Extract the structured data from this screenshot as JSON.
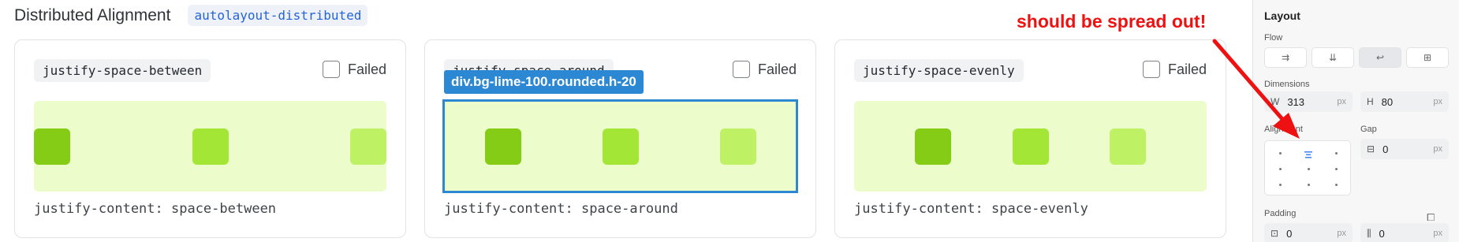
{
  "header": {
    "title": "Distributed Alignment",
    "badge": "autolayout-distributed"
  },
  "cards": [
    {
      "chip": "justify-space-between",
      "failed_label": "Failed",
      "caption": "justify-content: space-between"
    },
    {
      "chip": "justify-space-around",
      "failed_label": "Failed",
      "caption": "justify-content: space-around"
    },
    {
      "chip": "justify-space-evenly",
      "failed_label": "Failed",
      "caption": "justify-content: space-evenly"
    }
  ],
  "selection_label": "div.bg-lime-100.rounded.h-20",
  "annotation": "should be spread out!",
  "colors": {
    "lime_100": "#ecfccb",
    "lime_500": "#84cc16",
    "lime_400": "#a3e635",
    "lime_300": "#bef264",
    "selection": "#2d88d4",
    "annotation": "#ee1111"
  },
  "panel": {
    "title": "Layout",
    "flow_label": "Flow",
    "flow_icons": [
      "flow-horizontal-icon",
      "flow-vertical-icon",
      "flow-wrap-icon",
      "flow-grid-icon"
    ],
    "flow_active_index": 2,
    "dimensions_label": "Dimensions",
    "width": {
      "label": "W",
      "value": "313",
      "unit": "px"
    },
    "height": {
      "label": "H",
      "value": "80",
      "unit": "px"
    },
    "alignment_label": "Alignment",
    "gap_label": "Gap",
    "gap": {
      "value": "0",
      "unit": "px"
    },
    "padding_label": "Padding",
    "padding_h": {
      "value": "0",
      "unit": "px"
    },
    "padding_v": {
      "value": "0",
      "unit": "px"
    }
  }
}
